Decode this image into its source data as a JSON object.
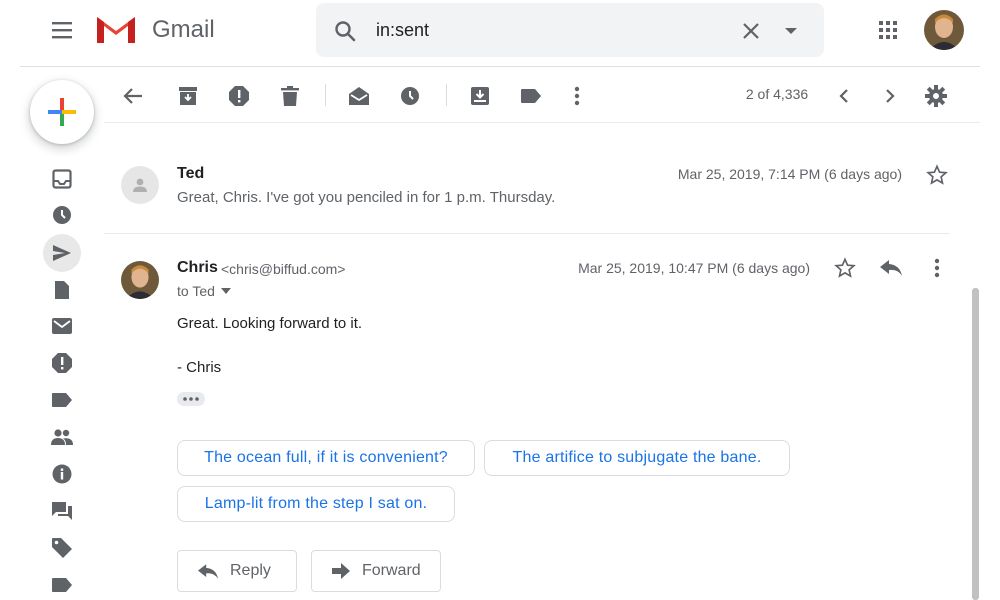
{
  "header": {
    "app_name": "Gmail",
    "search": {
      "value": "in:sent"
    }
  },
  "icons": {
    "menu": "hamburger-menu-icon",
    "search": "search-icon",
    "clear": "close-icon",
    "apps": "apps-grid-icon"
  },
  "colors": {
    "accent_blue": "#1a73e8",
    "gmail_red": "#ea4335",
    "icon_gray": "#5f6368"
  },
  "toolbar": {
    "page_count": "2 of 4,336"
  },
  "sidebar": {
    "items": [
      "inbox",
      "snoozed",
      "sent",
      "drafts",
      "all-mail",
      "spam",
      "label",
      "social",
      "updates",
      "forums",
      "promotions",
      "label"
    ],
    "active": "sent"
  },
  "thread": {
    "messages": [
      {
        "sender": "Ted",
        "date": "Mar 25, 2019, 7:14 PM (6 days ago)",
        "snippet": "Great, Chris. I've got you penciled in for 1 p.m. Thursday."
      },
      {
        "sender": "Chris",
        "email": "<chris@biffud.com>",
        "date": "Mar 25, 2019, 10:47 PM (6 days ago)",
        "to": "to Ted",
        "body_line1": "Great. Looking forward to it.",
        "body_line2": "- Chris"
      }
    ],
    "smart_replies": [
      "The ocean full, if it is convenient?",
      "The artifice to subjugate the bane.",
      "Lamp-lit from the step I sat on."
    ],
    "actions": {
      "reply": "Reply",
      "forward": "Forward"
    }
  }
}
